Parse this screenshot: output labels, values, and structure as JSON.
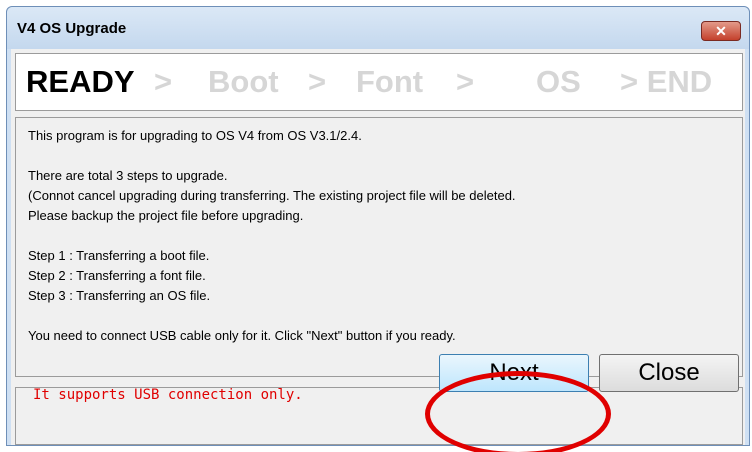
{
  "window": {
    "title": "V4 OS Upgrade",
    "close_glyph": "✕"
  },
  "steps": {
    "ready": "READY",
    "sep1": ">",
    "boot": "Boot",
    "sep2": ">",
    "font": "Font",
    "sep3": ">",
    "os": "OS",
    "end": "> END"
  },
  "content": {
    "line1": "This program is for upgrading to OS V4 from OS V3.1/2.4.",
    "line2": "There are total 3 steps to upgrade.",
    "line3": "(Connot cancel upgrading during transferring. The existing project file will be deleted.",
    "line4": "Please backup the project file before upgrading.",
    "line5": "Step 1 : Transferring a boot file.",
    "line6": "Step 2 : Transferring a font file.",
    "line7": "Step 3 : Transferring an OS file.",
    "line8": "You need to connect USB cable only for it. Click \"Next\" button if you ready."
  },
  "footer": {
    "note": "It supports USB connection only.",
    "next_label": "Next",
    "close_label": "Close"
  },
  "colors": {
    "accent_red": "#e00000",
    "active_step": "#000000",
    "inactive_step": "#d6d6d6"
  }
}
